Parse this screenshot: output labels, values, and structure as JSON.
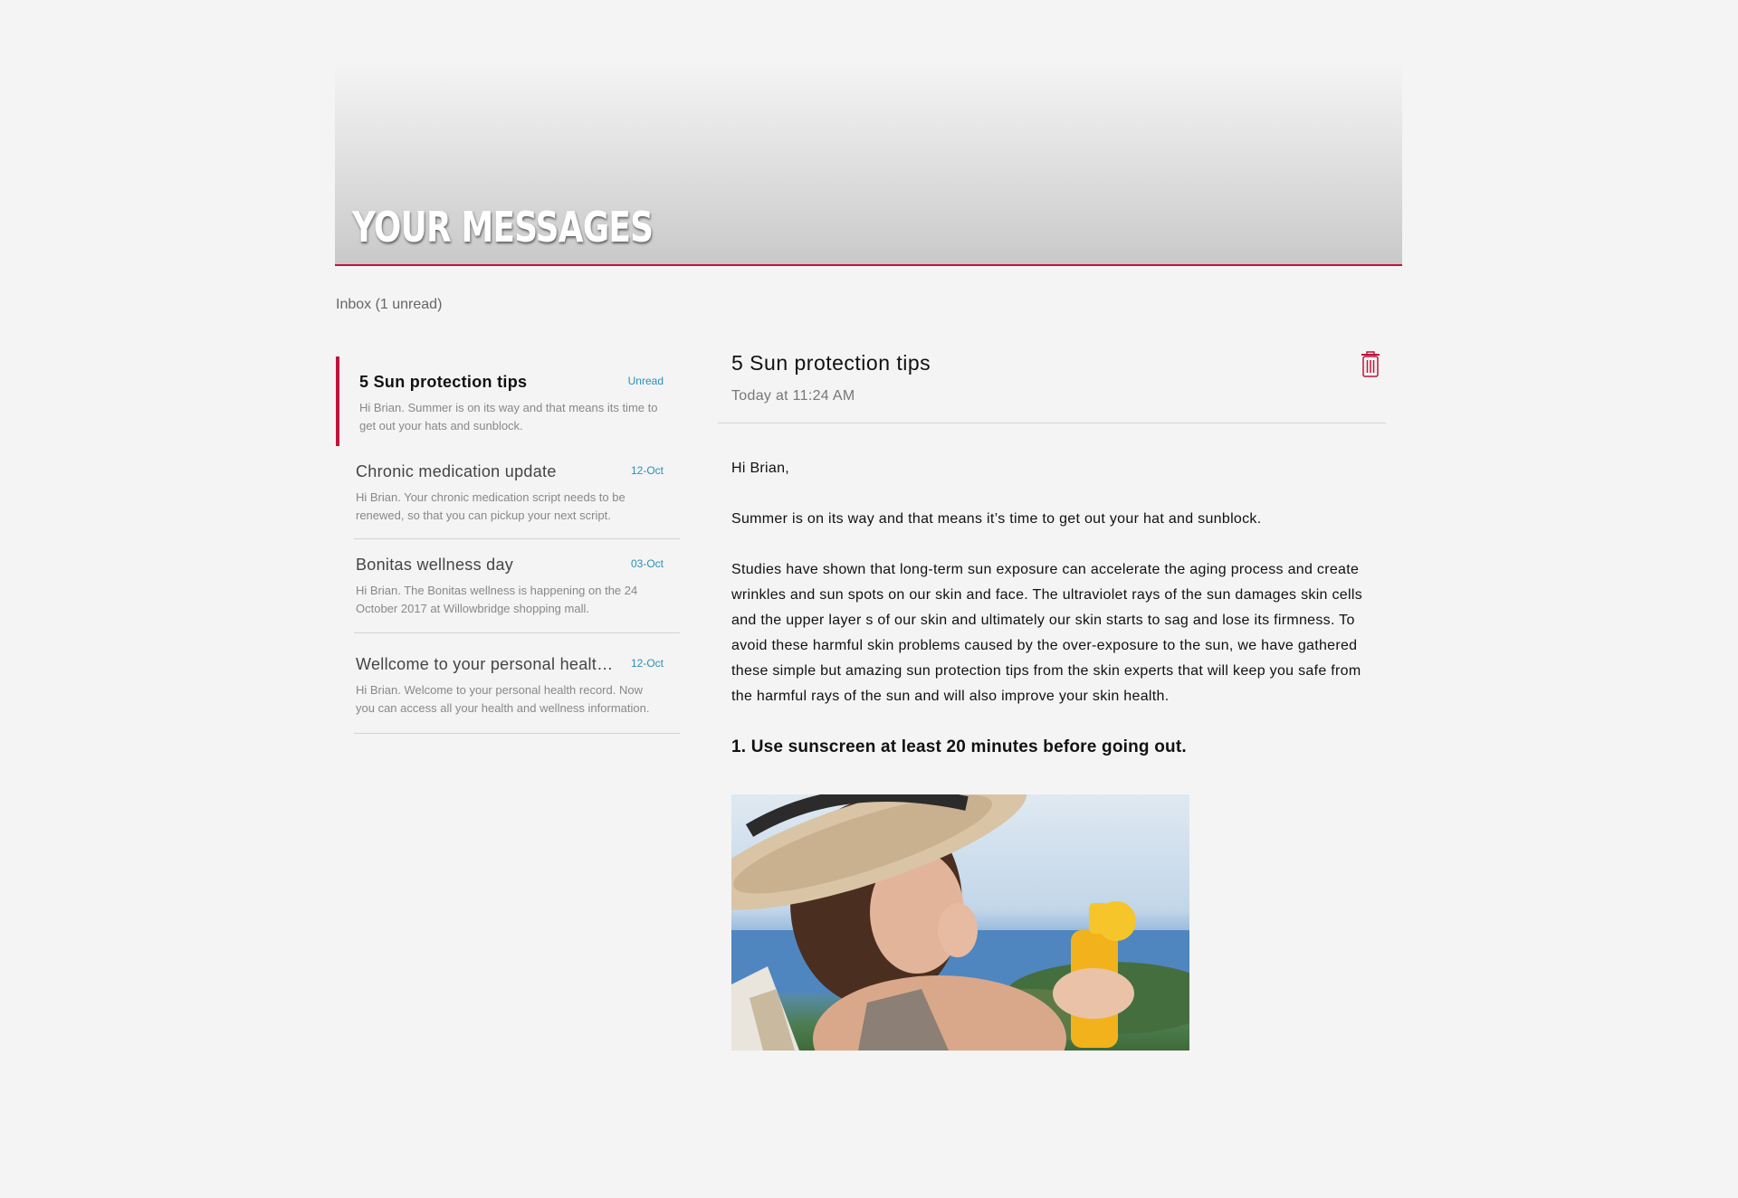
{
  "header": {
    "title": "YOUR MESSAGES",
    "accent_color": "#c0143c"
  },
  "inbox": {
    "label": "Inbox (1 unread)"
  },
  "messages": [
    {
      "subject": "5 Sun protection tips",
      "tag": "Unread",
      "preview": "Hi Brian. Summer is on its way and that means its time to get out your hats and sunblock."
    },
    {
      "subject": "Chronic medication update",
      "tag": "12-Oct",
      "preview": "Hi Brian. Your chronic medication script needs to be renewed, so that you can pickup your next script."
    },
    {
      "subject": "Bonitas wellness day",
      "tag": "03-Oct",
      "preview": "Hi Brian. The Bonitas wellness is happening on the 24 October 2017 at Willowbridge shopping mall."
    },
    {
      "subject": "Wellcome to your personal health record",
      "tag": "12-Oct",
      "preview": "Hi Brian. Welcome to your personal health record. Now you can access all your health and wellness information."
    }
  ],
  "detail": {
    "title": "5 Sun protection tips",
    "date": "Today at 11:24 AM",
    "delete_icon": "trash-icon",
    "greeting": "Hi Brian,",
    "paragraph1": "Summer is on its way and that means it’s time to get out your hat and sunblock.",
    "paragraph2": "Studies have shown that long-term sun exposure can accelerate the aging process and create wrinkles and sun spots on our skin and face. The ultraviolet rays of the sun damages skin cells and the upper layer s of our skin and ultimately our skin starts to sag and lose its firmness. To avoid these harmful skin problems caused by the over-exposure to the sun, we have gathered these simple but amazing sun protection tips from the skin experts that will keep you safe from the harmful rays of the sun and will also improve your skin health.",
    "tip1": "1. Use sunscreen at least 20 minutes before going out."
  }
}
